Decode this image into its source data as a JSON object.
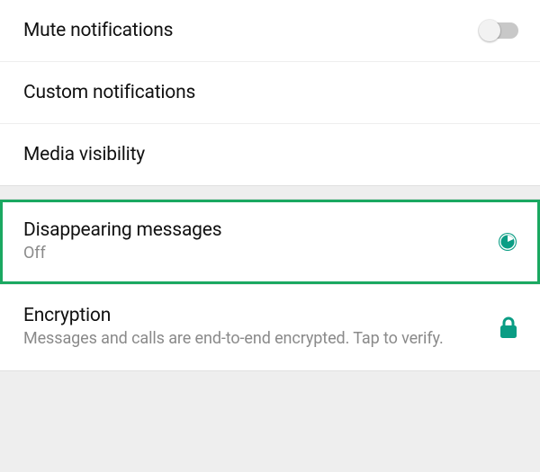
{
  "colors": {
    "accent": "#0a9d84"
  },
  "section1": {
    "mute": {
      "title": "Mute notifications",
      "state": "off"
    },
    "custom": {
      "title": "Custom notifications"
    },
    "media": {
      "title": "Media visibility"
    }
  },
  "section2": {
    "disappearing": {
      "title": "Disappearing messages",
      "subtitle": "Off",
      "icon": "timer-icon"
    },
    "encryption": {
      "title": "Encryption",
      "subtitle": "Messages and calls are end-to-end encrypted. Tap to verify.",
      "icon": "lock-icon"
    }
  }
}
